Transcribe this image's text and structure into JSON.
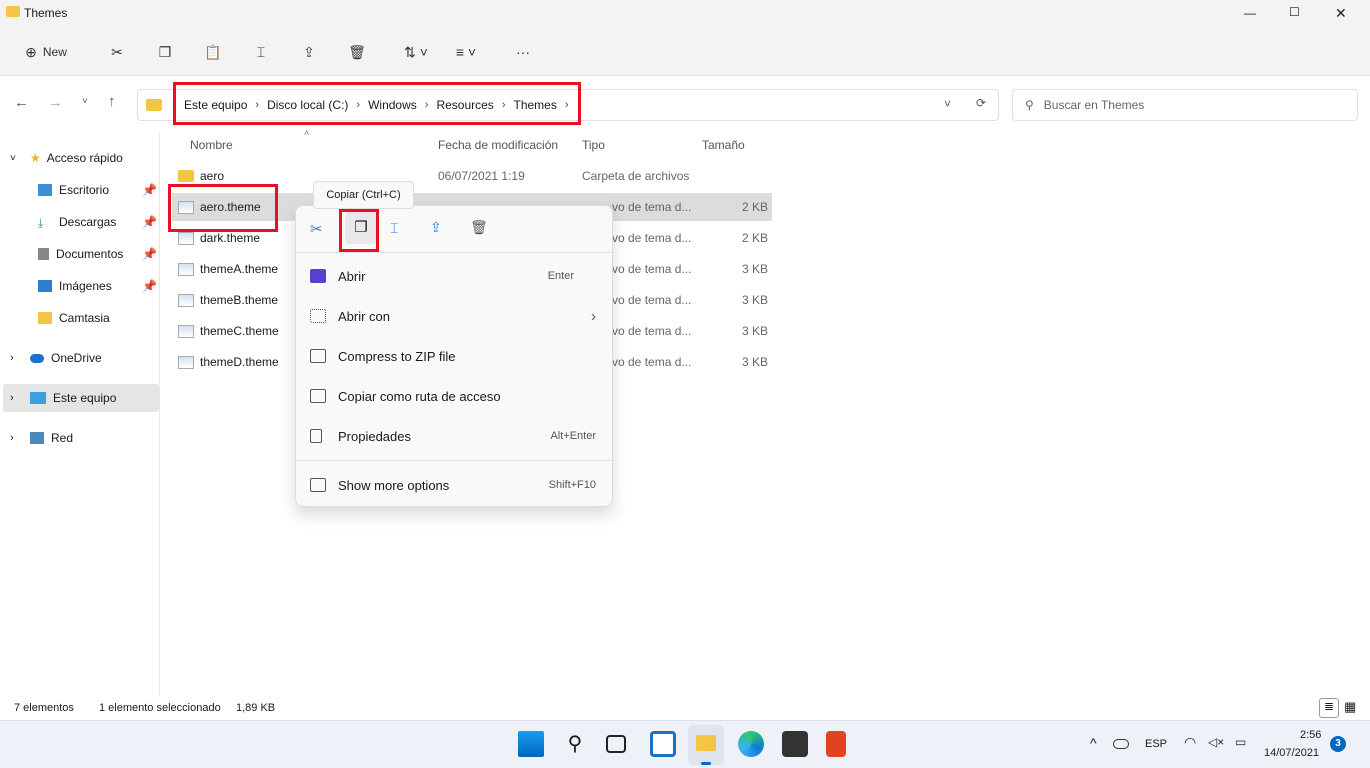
{
  "window": {
    "title": "Themes",
    "minimize": "—",
    "maximize": "☐",
    "close": "✕"
  },
  "toolbar": {
    "new_label": "New",
    "more": "···"
  },
  "address": {
    "crumbs": [
      "Este equipo",
      "Disco local (C:)",
      "Windows",
      "Resources",
      "Themes"
    ],
    "search_placeholder": "Buscar en Themes"
  },
  "sidebar": {
    "items": [
      {
        "label": "Acceso rápido"
      },
      {
        "label": "Escritorio"
      },
      {
        "label": "Descargas"
      },
      {
        "label": "Documentos"
      },
      {
        "label": "Imágenes"
      },
      {
        "label": "Camtasia"
      },
      {
        "label": "OneDrive"
      },
      {
        "label": "Este equipo"
      },
      {
        "label": "Red"
      }
    ]
  },
  "columns": {
    "name": "Nombre",
    "date": "Fecha de modificación",
    "type": "Tipo",
    "size": "Tamaño"
  },
  "files": [
    {
      "name": "aero",
      "date": "06/07/2021 1:19",
      "type": "Carpeta de archivos",
      "size": ""
    },
    {
      "name": "aero.theme",
      "date": "",
      "type": "vo de tema d...",
      "size": "2 KB"
    },
    {
      "name": "dark.theme",
      "date": "",
      "type": "vo de tema d...",
      "size": "2 KB"
    },
    {
      "name": "themeA.theme",
      "date": "",
      "type": "vo de tema d...",
      "size": "3 KB"
    },
    {
      "name": "themeB.theme",
      "date": "",
      "type": "vo de tema d...",
      "size": "3 KB"
    },
    {
      "name": "themeC.theme",
      "date": "",
      "type": "vo de tema d...",
      "size": "3 KB"
    },
    {
      "name": "themeD.theme",
      "date": "",
      "type": "vo de tema d...",
      "size": "3 KB"
    }
  ],
  "tooltip": "Copiar (Ctrl+C)",
  "context_menu": {
    "items": [
      {
        "label": "Abrir",
        "shortcut": "Enter"
      },
      {
        "label": "Abrir con",
        "shortcut": "›"
      },
      {
        "label": "Compress to ZIP file",
        "shortcut": ""
      },
      {
        "label": "Copiar como ruta de acceso",
        "shortcut": ""
      },
      {
        "label": "Propiedades",
        "shortcut": "Alt+Enter"
      },
      {
        "label": "Show more options",
        "shortcut": "Shift+F10"
      }
    ]
  },
  "status": {
    "count": "7 elementos",
    "selection": "1 elemento seleccionado",
    "size": "1,89 KB"
  },
  "tray": {
    "lang": "ESP",
    "time": "2:56",
    "date": "14/07/2021",
    "notifications": "3"
  },
  "colors": {
    "highlight": "#e81123",
    "accent": "#0067c0"
  }
}
